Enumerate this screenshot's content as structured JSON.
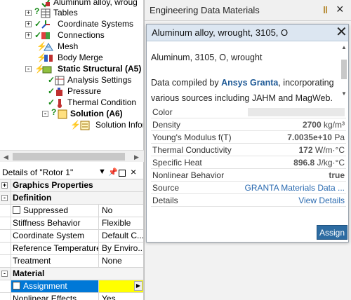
{
  "tree": {
    "items": [
      {
        "label": "Aluminum alloy, wroug"
      },
      {
        "label": "Tables"
      },
      {
        "label": "Coordinate Systems"
      },
      {
        "label": "Connections"
      },
      {
        "label": "Mesh"
      },
      {
        "label": "Body Merge"
      },
      {
        "label": "Static Structural (A5)"
      },
      {
        "label": "Analysis Settings"
      },
      {
        "label": "Pressure"
      },
      {
        "label": "Thermal Condition"
      },
      {
        "label": "Solution (A6)"
      },
      {
        "label": "Solution Inform"
      }
    ]
  },
  "details": {
    "title": "Details of \"Rotor 1\"",
    "rows": [
      {
        "type": "cat",
        "label": "Graphics Properties",
        "toggle": "+"
      },
      {
        "type": "cat",
        "label": "Definition",
        "toggle": "-"
      },
      {
        "type": "row",
        "label": "Suppressed",
        "value": "No",
        "checkbox": true
      },
      {
        "type": "row",
        "label": "Stiffness Behavior",
        "value": "Flexible"
      },
      {
        "type": "row",
        "label": "Coordinate System",
        "value": "Default C..."
      },
      {
        "type": "row",
        "label": "Reference Temperature",
        "value": "By Enviro..."
      },
      {
        "type": "row",
        "label": "Treatment",
        "value": "None"
      },
      {
        "type": "cat",
        "label": "Material",
        "toggle": "-"
      },
      {
        "type": "row",
        "label": "Assignment",
        "value": "",
        "checkbox": true,
        "selected": true
      },
      {
        "type": "row",
        "label": "Nonlinear Effects",
        "value": "Yes"
      }
    ]
  },
  "edm": {
    "title": "Engineering Data Materials",
    "popup": {
      "title": "Aluminum alloy, wrought, 3105, O",
      "subtitle": "Aluminum, 3105, O, wrought",
      "desc_prefix": "Data compiled by ",
      "desc_link": "Ansys Granta",
      "desc_suffix": ", incorporating various sources including JAHM and MagWeb.",
      "properties": [
        {
          "label": "Color",
          "value": "",
          "unit": ""
        },
        {
          "label": "Density",
          "value": "2700",
          "unit": "kg/m³"
        },
        {
          "label": "Young's Modulus f(T)",
          "value": "7.0035e+10",
          "unit": "Pa"
        },
        {
          "label": "Thermal Conductivity",
          "value": "172",
          "unit": "W/m·°C"
        },
        {
          "label": "Specific Heat",
          "value": "896.8",
          "unit": "J/kg·°C"
        },
        {
          "label": "Nonlinear Behavior",
          "value": "true",
          "unit": ""
        },
        {
          "label": "Source",
          "value": "GRANTA Materials Data ...",
          "unit": ""
        },
        {
          "label": "Details",
          "value": "View Details",
          "unit": ""
        }
      ],
      "assign_label": "Assign"
    }
  }
}
